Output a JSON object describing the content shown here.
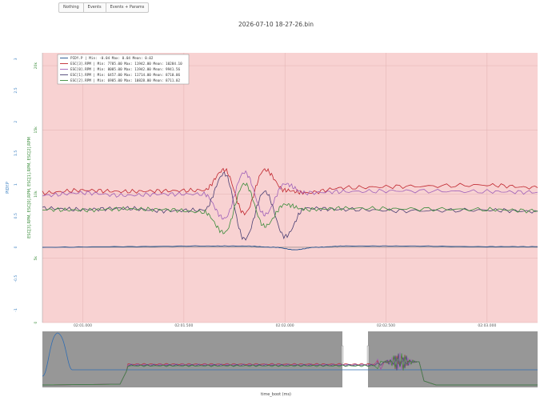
{
  "toolbar": {
    "buttons": [
      "Nothing",
      "Events",
      "Events + Params"
    ]
  },
  "chart_data": {
    "type": "line",
    "title": "2026-07-10 18-27-26.bin",
    "xlabel": "time_boot (ms)",
    "ylabel_left": "PIDY.P",
    "ylabel_right": "ESC[3].RPM, ESC[0].RPM, ESC[1].RPM, ESC[2].RPM",
    "x_ticks": [
      "02:01.000",
      "02:01.500",
      "02:02.000",
      "02:02.500",
      "02:03.000"
    ],
    "y_left_ticks": [
      "-1",
      "-0.5",
      "0",
      "0.5",
      "1",
      "1.5",
      "2",
      "2.5",
      "3"
    ],
    "y_right_ticks": [
      "0",
      "5k",
      "10k",
      "15k",
      "20k"
    ],
    "y_left_range": [
      -1.2,
      3.1
    ],
    "y_right_range": [
      0,
      21000
    ],
    "x_range_s": [
      120.8,
      123.25
    ],
    "background": "#f8d2d2",
    "grid": true,
    "legend_placement": "top-left",
    "series": [
      {
        "name": "PIDY.P",
        "legend": "PIDY.P | Min: -0.04     Max: 0.04     Mean: 0.02",
        "color": "#1f4e8c",
        "x": [
          120.8,
          121.2,
          121.6,
          121.8,
          121.95,
          122.05,
          122.15,
          122.3,
          122.6,
          123.0,
          123.25
        ],
        "y": [
          0.0,
          0.01,
          0.02,
          0.02,
          0.0,
          -0.04,
          0.0,
          0.02,
          0.02,
          0.01,
          0.01
        ]
      },
      {
        "name": "ESC[3].RPM",
        "legend": "ESC[3].RPM | Min: 7785.00     Max: 11942.00     Mean: 10284.10",
        "color": "#c0262e",
        "x": [
          120.8,
          121.0,
          121.2,
          121.4,
          121.6,
          121.7,
          121.8,
          121.9,
          122.0,
          122.1,
          122.3,
          122.6,
          123.0,
          123.25
        ],
        "y": [
          10100,
          10300,
          10200,
          10250,
          10300,
          11900,
          8500,
          11900,
          10300,
          10100,
          10500,
          10600,
          10700,
          10500
        ]
      },
      {
        "name": "ESC[0].RPM",
        "legend": "ESC[0].RPM | Min: 8085.00     Max: 11942.00     Mean: 9941.56",
        "color": "#9e5fb8",
        "x": [
          120.8,
          121.0,
          121.2,
          121.4,
          121.6,
          121.7,
          121.8,
          121.9,
          122.0,
          122.1,
          122.3,
          122.6,
          123.0,
          123.25
        ],
        "y": [
          9900,
          10100,
          9900,
          10000,
          10000,
          8100,
          11700,
          8400,
          10800,
          10100,
          10200,
          10250,
          10200,
          10150
        ]
      },
      {
        "name": "ESC[1].RPM",
        "legend": "ESC[1].RPM | Min: 6457.00     Max: 11714.00     Mean: 8710.06",
        "color": "#4a3f73",
        "x": [
          120.8,
          121.0,
          121.2,
          121.4,
          121.6,
          121.7,
          121.8,
          121.9,
          122.0,
          122.1,
          122.3,
          122.6,
          123.0,
          123.25
        ],
        "y": [
          8900,
          8800,
          8900,
          8700,
          8750,
          11600,
          6500,
          10200,
          6700,
          8900,
          8800,
          8700,
          8750,
          8650
        ]
      },
      {
        "name": "ESC[2].RPM",
        "legend": "ESC[2].RPM | Min: 6985.00     Max: 10828.00     Mean: 8711.02",
        "color": "#3b8c3b",
        "x": [
          120.8,
          121.0,
          121.2,
          121.4,
          121.6,
          121.7,
          121.8,
          121.9,
          122.0,
          122.1,
          122.3,
          122.6,
          123.0,
          123.25
        ],
        "y": [
          8800,
          8750,
          8850,
          8800,
          8600,
          7000,
          10800,
          7500,
          9200,
          8800,
          8900,
          8850,
          8800,
          8700
        ]
      }
    ]
  }
}
